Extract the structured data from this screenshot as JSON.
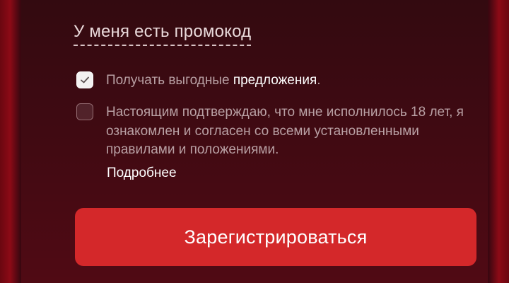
{
  "promo": {
    "label": "У меня есть промокод"
  },
  "offers_checkbox": {
    "checked": true,
    "label_prefix": "Получать выгодные ",
    "label_highlight": "предложения",
    "label_suffix": "."
  },
  "age_checkbox": {
    "checked": false,
    "label": "Настоящим подтверждаю, что мне исполнилось 18 лет, я ознакомлен и согласен со всеми установленными правилами и положениями."
  },
  "more_link": {
    "label": "Подробнее"
  },
  "register_button": {
    "label": "Зарегистрироваться"
  },
  "icons": {
    "checkmark": "checkmark-icon"
  },
  "colors": {
    "button": "#d4282a",
    "panel": "#3e0a12"
  }
}
